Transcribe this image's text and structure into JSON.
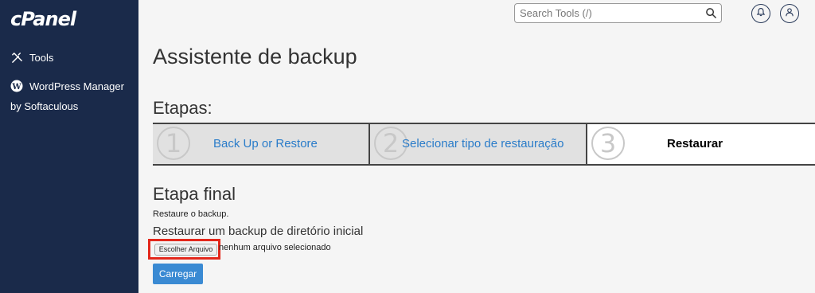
{
  "sidebar": {
    "logo": "cPanel",
    "items": [
      {
        "label": "Tools"
      },
      {
        "label": "WordPress Manager",
        "sublabel": "by Softaculous"
      }
    ]
  },
  "topbar": {
    "search_placeholder": "Search Tools (/)"
  },
  "main": {
    "page_title": "Assistente de backup",
    "steps_title": "Etapas:",
    "steps": [
      {
        "number": "1",
        "label": "Back Up or Restore"
      },
      {
        "number": "2",
        "label": "Selecionar tipo de restauração"
      },
      {
        "number": "3",
        "label": "Restaurar"
      }
    ],
    "final_title": "Etapa final",
    "restore_text": "Restaure o backup.",
    "dir_title": "Restaurar um backup de diretório inicial",
    "choose_file_label": "Escolher Arquivo",
    "no_file_text": "nenhum arquivo selecionado",
    "upload_label": "Carregar"
  },
  "colors": {
    "sidebar_bg": "#1a2a4a",
    "link": "#2a7cc9",
    "primary_button": "#3a8ad3",
    "highlight": "#e3271b"
  },
  "icons": [
    "tools-icon",
    "wordpress-icon",
    "search-icon",
    "bell-icon",
    "user-icon"
  ]
}
